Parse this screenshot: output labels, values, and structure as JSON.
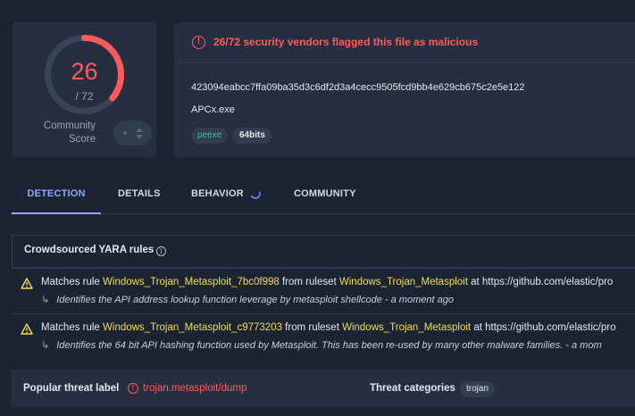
{
  "score": {
    "detections": "26",
    "total": "/ 72",
    "detections_value": 26,
    "total_value": 72,
    "community_label": "Community\nScore",
    "accent": "#ff5a5a"
  },
  "file": {
    "alert": "26/72 security vendors flagged this file as malicious",
    "hash": "423094eabcc7ffa09ba35d3c6df2d3a4cecc9505fcd9bb4e629cb675c2e5e122",
    "name": "APCx.exe",
    "tags": [
      "peexe",
      "64bits"
    ]
  },
  "tabs": [
    "DETECTION",
    "DETAILS",
    "BEHAVIOR",
    "COMMUNITY"
  ],
  "yara": {
    "title": "Crowdsourced YARA rules",
    "rows": [
      {
        "prefix": "Matches rule ",
        "rule": "Windows_Trojan_Metasploit_7bc0f998",
        "mid": " from ruleset ",
        "ruleset": "Windows_Trojan_Metasploit",
        "suffix": " at https://github.com/elastic/pro",
        "desc": "Identifies the API address lookup function leverage by metasploit shellcode - a moment ago"
      },
      {
        "prefix": "Matches rule ",
        "rule": "Windows_Trojan_Metasploit_c9773203",
        "mid": " from ruleset ",
        "ruleset": "Windows_Trojan_Metasploit",
        "suffix": " at https://github.com/elastic/pro",
        "desc": "Identifies the 64 bit API hashing function used by Metasploit. This has been re-used by many other malware families. - a mom"
      }
    ]
  },
  "threat": {
    "popular_label": "Popular threat label",
    "popular_value": "trojan.metasploit/dump",
    "categories_label": "Threat categories",
    "category": "trojan"
  }
}
